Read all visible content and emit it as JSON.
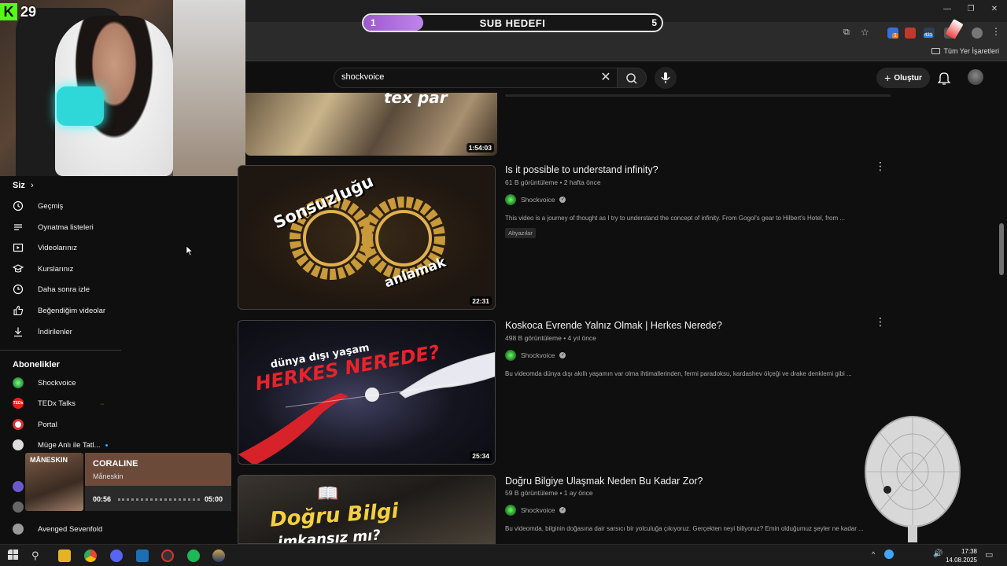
{
  "overlay": {
    "kick_viewer_count": "29",
    "sub_goal": {
      "label": "SUB HEDEFI",
      "current": "1",
      "target": "5",
      "progress": 0.2
    }
  },
  "browser": {
    "bookmarks_label": "Tüm Yer İşaretleri",
    "ext_badge_1": "1",
    "ext_badge_2": "431"
  },
  "header": {
    "search_value": "shockvoice",
    "create_label": "Oluştur"
  },
  "sidebar": {
    "you_heading": "Siz",
    "items": [
      {
        "label": "Geçmiş",
        "icon": "history-icon"
      },
      {
        "label": "Oynatma listeleri",
        "icon": "playlist-icon"
      },
      {
        "label": "Videolarınız",
        "icon": "your-videos-icon"
      },
      {
        "label": "Kurslarınız",
        "icon": "courses-icon"
      },
      {
        "label": "Daha sonra izle",
        "icon": "watch-later-icon"
      },
      {
        "label": "Beğendiğim videolar",
        "icon": "liked-videos-icon"
      },
      {
        "label": "İndirilenler",
        "icon": "downloads-icon"
      }
    ],
    "subs_heading": "Abonelikler",
    "subscriptions": [
      {
        "label": "Shockvoice",
        "color": "#3aa84a"
      },
      {
        "label": "TEDx Talks",
        "color": "#e62117"
      },
      {
        "label": "Portal",
        "color": "#e03030"
      },
      {
        "label": "Müge Anlı ile Tatl...",
        "color": "#dddddd"
      },
      {
        "label": "Avenged Sevenfold",
        "color": "#888888"
      }
    ]
  },
  "videos": [
    {
      "duration": "1:54:03",
      "thumb_text": "tex par"
    },
    {
      "title": "Is it possible to understand infinity?",
      "meta": "61 B görüntüleme • 2 hafta önce",
      "channel": "Shockvoice",
      "description": "This video is a journey of thought as I try to understand the concept of infinity. From Gogol's gear to Hilbert's Hotel, from ...",
      "badge": "Altyazılar",
      "duration": "22:31",
      "thumb_top": "Sonsuzluğu",
      "thumb_bottom": "anlamak"
    },
    {
      "title": "Koskoca Evrende Yalnız Olmak | Herkes Nerede?",
      "meta": "498 B görüntüleme • 4 yıl önce",
      "channel": "Shockvoice",
      "description": "Bu videomda dünya dışı akıllı yaşamın var olma ihtimallerinden, fermi paradoksu, kardashev ölçeği ve drake denklemi gibi ...",
      "duration": "25:34",
      "thumb_top": "dünya dışı yaşam",
      "thumb_bottom": "HERKES NEREDE?"
    },
    {
      "title": "Doğru Bilgiye Ulaşmak Neden Bu Kadar Zor?",
      "meta": "59 B görüntüleme • 1 ay önce",
      "channel": "Shockvoice",
      "description": "Bu videomda, bilginin doğasına dair sarsıcı bir yolculuğa çıkıyoruz. Gerçekten neyi biliyoruz? Emin olduğumuz şeyler ne kadar ...",
      "thumb_top": "Doğru Bilgi",
      "thumb_bottom": "imkansız mı?"
    }
  ],
  "spotify": {
    "cover_text": "MÅNESKIN",
    "song": "CORALINE",
    "artist": "Måneskin",
    "elapsed": "00:56",
    "total": "05:00"
  },
  "taskbar": {
    "time": "17:38",
    "date": "14.08.2025"
  }
}
